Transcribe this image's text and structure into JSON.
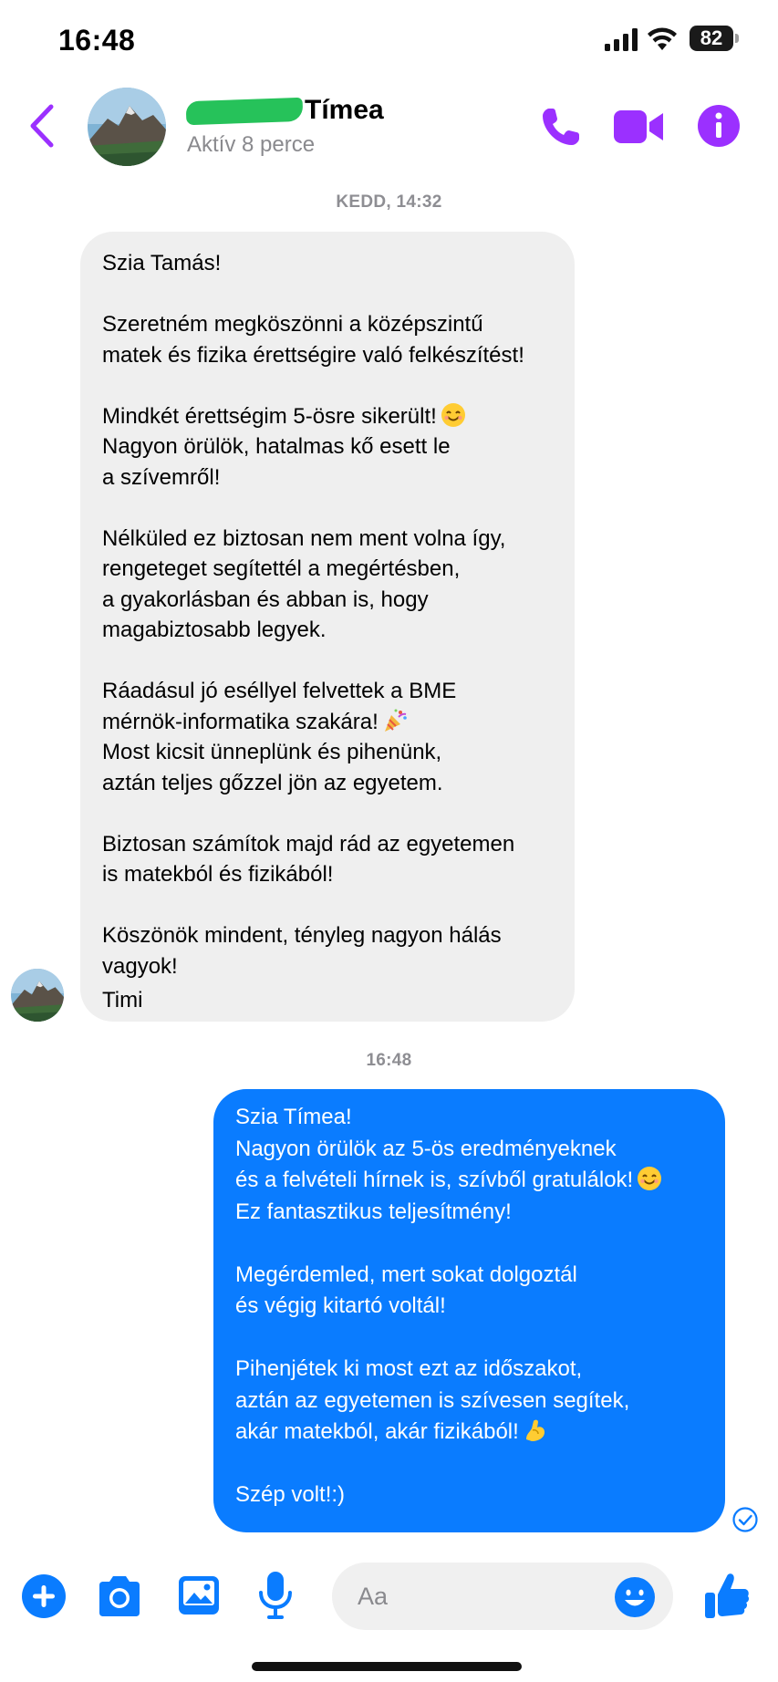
{
  "status_bar": {
    "time": "16:48",
    "battery": "82",
    "battery_level": 0.82
  },
  "header": {
    "back_icon": "chevron-left-icon",
    "contact_name": "Tímea",
    "contact_status": "Aktív 8 perce",
    "icons": [
      "phone-icon",
      "video-camera-icon",
      "info-icon"
    ],
    "accent_color": "#9b30ff"
  },
  "conversation": {
    "timestamp_1": "KEDD, 14:32",
    "incoming_message": {
      "lines": [
        "Szia Tamás!",
        "",
        "Szeretném megköszönni a középszintű",
        "matek és fizika érettségire való felkészítést!",
        "",
        "Mindkét érettségim 5-ösre sikerült!",
        "Nagyon örülök, hatalmas kő esett le",
        "a szívemről!",
        "",
        "Nélküled ez biztosan nem ment volna így,",
        "rengeteget segítettél a megértésben,",
        "a gyakorlásban és abban is, hogy",
        "magabiztosabb legyek.",
        "",
        "Ráadásul jó eséllyel felvettek a BME",
        "mérnök-informatika szakára!",
        "Most kicsit ünneplünk és pihenünk,",
        "aztán teljes gőzzel jön az egyetem.",
        "",
        "Biztosan számítok majd rád az egyetemen",
        "is matekból és fizikából!",
        "",
        "Köszönök mindent, tényleg nagyon hálás",
        "vagyok!",
        "Timi"
      ],
      "bubble_color": "#efefef"
    },
    "timestamp_2": "16:48",
    "outgoing_message": {
      "lines": [
        "Szia Tímea!",
        "Nagyon örülök az 5-ös eredményeknek",
        "és a felvételi hírnek is, szívből gratulálok!",
        "Ez fantasztikus teljesítmény!",
        "",
        "Megérdemled, mert sokat dolgoztál",
        "és végig kitartó voltál!",
        "",
        "Pihenjétek ki most ezt az időszakot,",
        "aztán az egyetemen is szívesen segítek,",
        "akár matekból, akár fizikából!",
        "",
        "Szép volt!:)"
      ],
      "bubble_color": "#0a7cff"
    }
  },
  "composer": {
    "placeholder": "Aa",
    "icons": [
      "plus-icon",
      "camera-icon",
      "image-icon",
      "microphone-icon",
      "emoji-icon",
      "thumbs-up-icon"
    ],
    "icon_color": "#0a7cff"
  }
}
